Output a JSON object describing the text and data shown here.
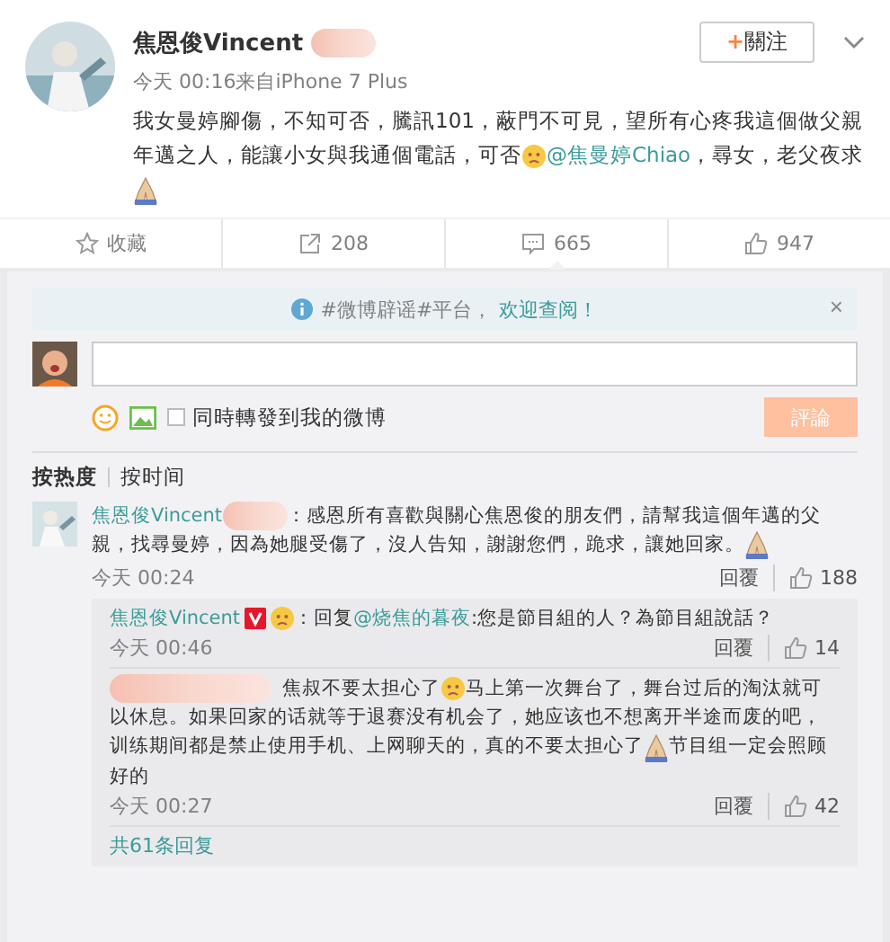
{
  "post": {
    "author": "焦恩俊Vincent",
    "meta": "今天 00:16来自iPhone 7 Plus",
    "follow": {
      "plus": "+",
      "label": "關注"
    },
    "parts": [
      {
        "kind": "text",
        "text": "我女曼婷腳傷，不知可否，騰訊101，蔽門不可見，望所有心疼我這個做父親年邁之人，能讓小女與我通個電話，可否"
      },
      {
        "kind": "emoji"
      },
      {
        "kind": "mention",
        "text": "@焦曼婷Chiao"
      },
      {
        "kind": "text",
        "text": "，尋女，老父夜求"
      },
      {
        "kind": "gesture"
      }
    ],
    "actions": [
      {
        "kind": "star",
        "label": "收藏",
        "selected": false
      },
      {
        "kind": "share",
        "label": "208",
        "selected": false
      },
      {
        "kind": "comment",
        "label": "665",
        "selected": true
      },
      {
        "kind": "like",
        "label": "947",
        "selected": false
      }
    ]
  },
  "notice": {
    "text": "#微博辟谣#平台，",
    "link": "欢迎查阅！",
    "close": "×"
  },
  "composer": {
    "checkbox": {
      "label": "同時轉發到我的微博",
      "checked": false
    },
    "submit": {
      "label": "評論",
      "disabled": true
    }
  },
  "sort_tabs": [
    {
      "label": "按热度",
      "selected": true
    },
    {
      "label": "按时间",
      "selected": false
    }
  ],
  "comment": {
    "author": "焦恩俊Vincent",
    "parts": [
      {
        "kind": "text",
        "text": "：感恩所有喜歡與關心焦恩俊的朋友們，請幫我這個年邁的父親，找尋曼婷，因為她腿受傷了，沒人告知，謝謝您們，跪求，讓她回家。"
      },
      {
        "kind": "gesture"
      }
    ],
    "time": "今天 00:24",
    "reply": "回覆",
    "likes": "188",
    "replies": [
      {
        "author": "焦恩俊Vincent",
        "verified": true,
        "parts": [
          {
            "kind": "text",
            "text": "：回复"
          },
          {
            "kind": "mention",
            "text": "@烧焦的暮夜"
          },
          {
            "kind": "text",
            "text": ":您是節目組的人？為節目組說話？"
          }
        ],
        "time": "今天 00:46",
        "reply": "回覆",
        "likes": "14"
      },
      {
        "verified": false,
        "parts": [
          {
            "kind": "text",
            "text": "焦叔不要太担心了"
          },
          {
            "kind": "emoji"
          },
          {
            "kind": "text",
            "text": "马上第一次舞台了，舞台过后的淘汰就可以休息。如果回家的话就等于退赛没有机会了，她应该也不想离开半途而废的吧，训练期间都是禁止使用手机、上网聊天的，真的不要太担心了"
          },
          {
            "kind": "gesture"
          },
          {
            "kind": "text",
            "text": "节目组一定会照顾好的"
          }
        ],
        "time": "今天 00:27",
        "reply": "回覆",
        "likes": "42"
      }
    ],
    "more": "共61条回复"
  }
}
